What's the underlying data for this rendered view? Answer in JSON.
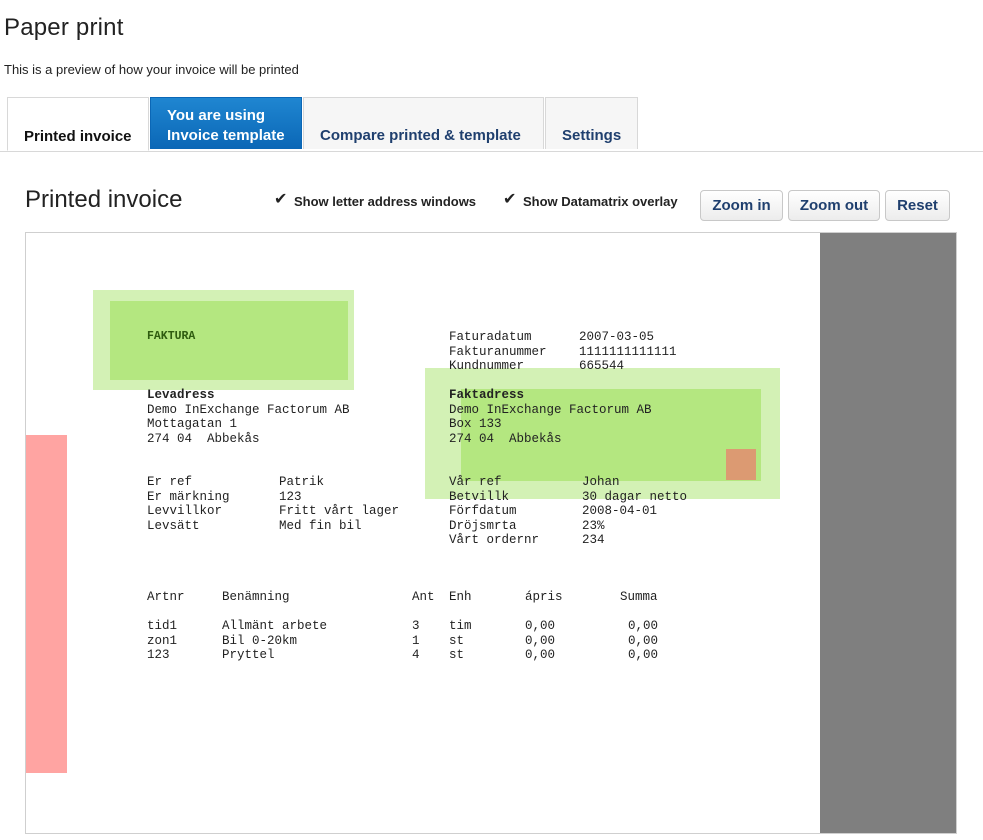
{
  "header": {
    "title": "Paper print",
    "subtitle": "This is a preview of how your invoice will be printed"
  },
  "tabs": [
    {
      "label": "Printed invoice",
      "active": true
    },
    {
      "label_line1": "You are using",
      "label_line2": "Invoice template"
    },
    {
      "label": "Compare printed & template"
    },
    {
      "label": "Settings"
    }
  ],
  "section": {
    "title": "Printed invoice",
    "show_windows_label": "Show letter address windows",
    "show_windows_checked": true,
    "show_datamatrix_label": "Show Datamatrix overlay",
    "show_datamatrix_checked": true,
    "zoom_in_label": "Zoom in",
    "zoom_out_label": "Zoom out",
    "reset_label": "Reset",
    "check_glyph": "✔"
  },
  "invoice": {
    "faktura": "FAKTURA",
    "dates": {
      "labels": [
        "Faturadatum",
        "Fakturanummer",
        "Kundnummer"
      ],
      "values": [
        "2007-03-05",
        "1111111111111",
        "665544"
      ]
    },
    "levadress": {
      "heading": "Levadress",
      "lines": [
        "Demo InExchange Factorum AB",
        "Mottagatan 1",
        "274 04  Abbekås"
      ]
    },
    "faktadress": {
      "heading": "Faktadress",
      "lines": [
        "Demo InExchange Factorum AB",
        "Box 133",
        "274 04  Abbekås"
      ]
    },
    "refs_left": {
      "labels": [
        "Er ref",
        "Er märkning",
        "Levvillkor",
        "Levsätt"
      ],
      "values": [
        "Patrik",
        "123",
        "Fritt vårt lager",
        "Med fin bil"
      ]
    },
    "refs_right": {
      "labels": [
        "Vår ref",
        "Betvillk",
        "Förfdatum",
        "Dröjsmrta",
        "Vårt ordernr"
      ],
      "values": [
        "Johan",
        "30 dagar netto",
        "2008-04-01",
        "23%",
        "234"
      ]
    },
    "table": {
      "headers": [
        "Artnr",
        "Benämning",
        "Ant",
        "Enh",
        "ápris",
        "Summa"
      ],
      "rows": [
        [
          "tid1",
          "Allmänt arbete",
          "3",
          "tim",
          "0,00",
          "0,00"
        ],
        [
          "zon1",
          "Bil 0-20km",
          "1",
          "st",
          "0,00",
          "0,00"
        ],
        [
          "123",
          "Pryttel",
          "4",
          "st",
          "0,00",
          "0,00"
        ]
      ]
    }
  },
  "colors": {
    "tab_blue": "#0b67b6",
    "window_outer": "#d3f1b5",
    "window_inner": "#b4e780",
    "margin_gray": "#7f7f7f",
    "red_strip": "#ffa4a2",
    "datamatrix": "#dc9a72"
  }
}
